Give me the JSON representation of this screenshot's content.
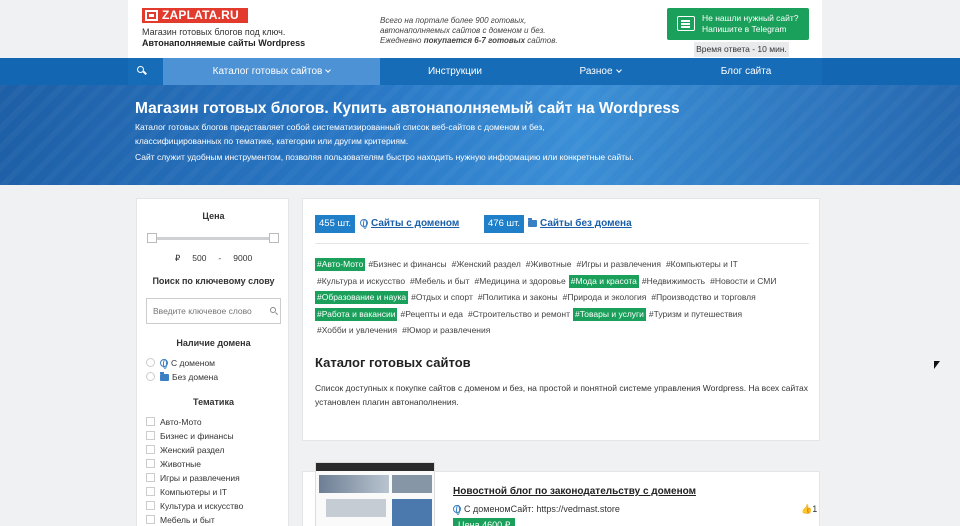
{
  "header": {
    "logo_text": "ZAPLATA.RU",
    "tagline": "Магазин готовых блогов под ключ.",
    "tagline_bold": "Автонаполняемые сайты Wordpress",
    "info_line1": "Всего на портале более 900 готовых,",
    "info_line2": "автонаполняемых сайтов с доменом и без.",
    "info_line3_pre": "Ежедневно ",
    "info_line3_bold": "покупается 6-7 готовых",
    "info_line3_post": " сайтов.",
    "telegram_line1": "Не нашли нужный сайт?",
    "telegram_line2": "Напишите в Telegram",
    "response_time": "Время ответа - 10 мин."
  },
  "nav": {
    "items": [
      {
        "label": "Каталог готовых сайтов"
      },
      {
        "label": "Инструкции"
      },
      {
        "label": "Разное"
      },
      {
        "label": "Блог сайта"
      }
    ]
  },
  "hero": {
    "title": "Магазин готовых блогов. Купить автонаполняемый сайт на Wordpress",
    "p1": "Каталог готовых блогов представляет собой систематизированный список веб-сайтов с доменом и без, классифицированных по тематике, категории или другим критериям.",
    "p2": "Сайт служит удобным инструментом, позволяя пользователям быстро находить нужную информацию или конкретные сайты."
  },
  "sidebar": {
    "price_title": "Цена",
    "currency": "₽",
    "price_min": "500",
    "price_sep": "-",
    "price_max": "9000",
    "keyword_title": "Поиск по ключевому слову",
    "keyword_placeholder": "Введите ключевое слово",
    "domain_title": "Наличие домена",
    "domain_options": [
      "С доменом",
      "Без домена"
    ],
    "topics_title": "Тематика",
    "topics": [
      "Авто-Мото",
      "Бизнес и финансы",
      "Женский раздел",
      "Животные",
      "Игры и развлечения",
      "Компьютеры и IT",
      "Культура и искусство",
      "Мебель и быт"
    ]
  },
  "catalog": {
    "with_domain_count": "455 шт.",
    "with_domain_label": "Сайты с доменом",
    "without_domain_count": "476 шт.",
    "without_domain_label": "Сайты без домена",
    "tags": [
      {
        "label": "#Авто-Мото",
        "active": true
      },
      {
        "label": "#Бизнес и финансы",
        "active": false
      },
      {
        "label": "#Женский раздел",
        "active": false
      },
      {
        "label": "#Животные",
        "active": false
      },
      {
        "label": "#Игры и развлечения",
        "active": false
      },
      {
        "label": "#Компьютеры и IT",
        "active": false
      },
      {
        "label": "#Культура и искусство",
        "active": false
      },
      {
        "label": "#Мебель и быт",
        "active": false
      },
      {
        "label": "#Медицина и здоровье",
        "active": false
      },
      {
        "label": "#Мода и красота",
        "active": true
      },
      {
        "label": "#Недвижимость",
        "active": false
      },
      {
        "label": "#Новости и СМИ",
        "active": false
      },
      {
        "label": "#Образование и наука",
        "active": true
      },
      {
        "label": "#Отдых и спорт",
        "active": false
      },
      {
        "label": "#Политика и законы",
        "active": false
      },
      {
        "label": "#Природа и экология",
        "active": false
      },
      {
        "label": "#Производство и торговля",
        "active": false
      },
      {
        "label": "#Работа и вакансии",
        "active": true
      },
      {
        "label": "#Рецепты и еда",
        "active": false
      },
      {
        "label": "#Строительство и ремонт",
        "active": false
      },
      {
        "label": "#Товары и услуги",
        "active": true
      },
      {
        "label": "#Туризм и путешествия",
        "active": false
      },
      {
        "label": "#Хобби и увлечения",
        "active": false
      },
      {
        "label": "#Юмор и развлечения",
        "active": false
      }
    ],
    "title": "Каталог готовых сайтов",
    "description": "Список доступных к покупке сайтов с доменом и без, на простой и понятной системе управления Wordpress. На всех сайтах установлен плагин автонаполнения."
  },
  "product": {
    "title": "Новостной блог по законодательству с доменом",
    "domain_text": "С доменомСайт: https://vedmast.store",
    "likes": "1",
    "price": "Цена 4600 ₽"
  },
  "colors": {
    "nav_blue": "#176cb8",
    "nav_active": "#4c92d4",
    "accent_green": "#1aa05a",
    "logo_red": "#e23b2e",
    "badge_blue": "#1f7fc8"
  }
}
